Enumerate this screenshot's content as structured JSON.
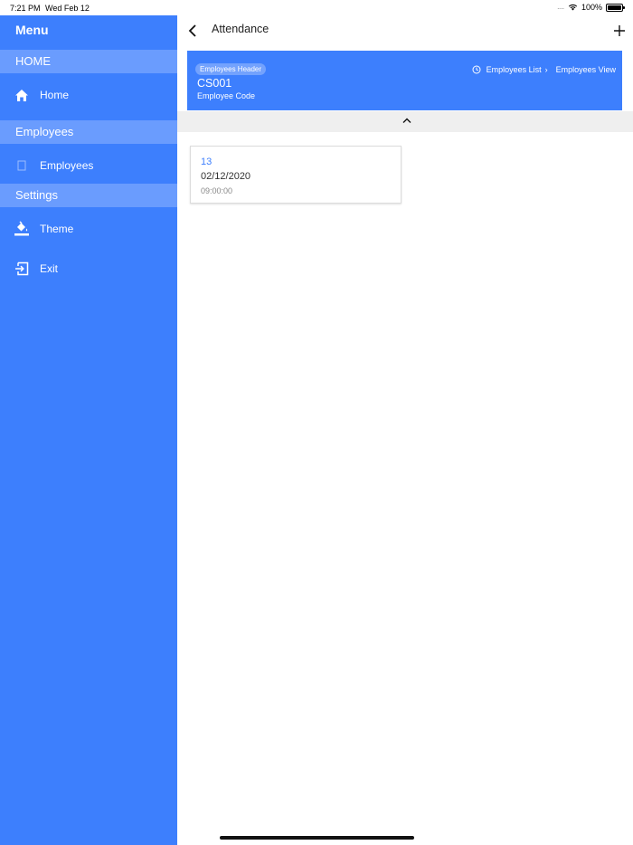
{
  "status_bar": {
    "time": "7:21 PM",
    "date": "Wed Feb 12",
    "signal": "....",
    "battery": "100%"
  },
  "sidebar": {
    "title": "Menu",
    "sections": [
      {
        "label": "HOME",
        "items": [
          {
            "label": "Home",
            "icon": "home-icon"
          }
        ]
      },
      {
        "label": "Employees",
        "items": [
          {
            "label": "Employees",
            "icon": "employees-icon"
          }
        ]
      },
      {
        "label": "Settings",
        "items": [
          {
            "label": "Theme",
            "icon": "paint-bucket-icon"
          },
          {
            "label": "Exit",
            "icon": "exit-icon"
          }
        ]
      }
    ]
  },
  "header": {
    "title": "Attendance"
  },
  "employee_header": {
    "chip": "Employees Header",
    "code": "CS001",
    "subtitle": "Employee Code",
    "breadcrumb": {
      "first": "Employees List",
      "second": "Employees View"
    }
  },
  "records": [
    {
      "id": "13",
      "date": "02/12/2020",
      "time": "09:00:00"
    }
  ],
  "colors": {
    "primary": "#3d7ffd",
    "section": "#6a9cfe",
    "collapse_bar": "#efefef"
  }
}
